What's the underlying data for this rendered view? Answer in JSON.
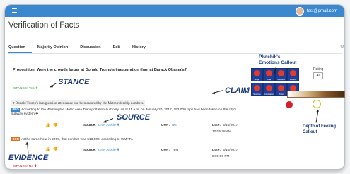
{
  "app": {
    "title": "Verification of Facts",
    "user_email": "test@gmail.com"
  },
  "tabs": [
    "Question",
    "Majority Opinion",
    "Discussion",
    "Edit",
    "History"
  ],
  "proposition": "Proposition: Were the crowds larger at Donald Trump's inauguration than at Barack Obama's?",
  "stance": {
    "text": "STANCE: Yes",
    "mark": "✚"
  },
  "claim": "▾ Donald Trump's inauguration attendance can be measured by the Metro ridership numbers.",
  "evidence": [
    {
      "tag": "PRO",
      "text": "According to the Washington Metro Area Transportation Authority, as of 11 a.m. on January 20, 2017, 193,000 trips had been taken on the city's subway system ✚",
      "source_label": "Source:",
      "source": "CNN Article ✚",
      "user_label": "User:",
      "user": "test",
      "date_label": "Date:",
      "date": "5/10/2017",
      "time": "10:05:28 AM"
    },
    {
      "tag": "CON",
      "text": "At the same hour in 2009, that number was 513,000, according to WMATA",
      "source_label": "Source:",
      "source": "CNN Article ✚",
      "user_label": "User:",
      "user": "Test",
      "date_label": "Date:",
      "date": "5/10/2017",
      "time": "2:06:09 PM"
    }
  ],
  "stance2": {
    "text": "STANCE: No",
    "mark": "✚"
  },
  "emotions": [
    "Anger",
    "Fear",
    "Sadness",
    "Disgust",
    "Surprise",
    "Anticipation",
    "Trust",
    "Joy"
  ],
  "rating": {
    "label": "Rating",
    "value": "All"
  },
  "callouts": {
    "stance": "STANCE",
    "source": "SOURCE",
    "claim": "CLAIM",
    "evidence": "EVIDENCE",
    "plutchik": "Plutchik's\nEmotions Callout",
    "depth": "Depth of Feeling\nCallout"
  },
  "colors": {
    "topbar": "#3b88cf",
    "emotion_cell": "#1f3f99",
    "emotion_dot": "#e13b2e",
    "yes": "#3a9a3a",
    "no": "#d02020"
  }
}
